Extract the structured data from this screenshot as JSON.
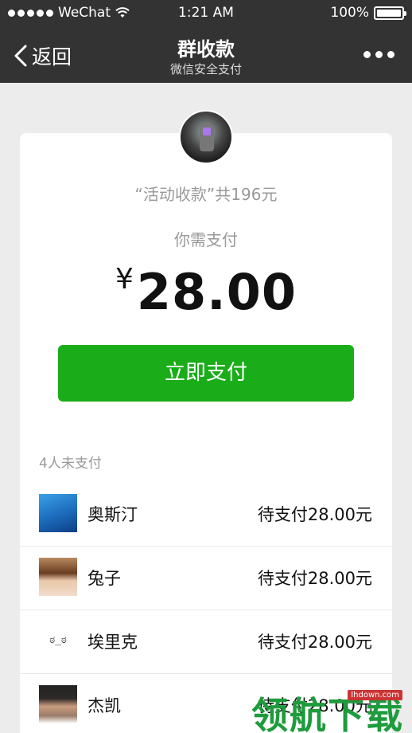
{
  "status_bar": {
    "carrier": "WeChat",
    "time": "1:21 AM",
    "battery": "100%",
    "signal_icon": "signal-dots-icon",
    "wifi_icon": "wifi-icon",
    "battery_icon": "battery-icon",
    "battery_level": 1.0
  },
  "nav": {
    "back_label": "返回",
    "title": "群收款",
    "subtitle": "微信安全支付",
    "back_icon": "chevron-left-icon",
    "more_icon": "more-dots-icon"
  },
  "payment": {
    "summary": "“活动收款”共196元",
    "need_pay_label": "你需支付",
    "currency": "¥",
    "amount": "28.00",
    "pay_button": "立即支付"
  },
  "unpaid": {
    "title": "4人未支付",
    "members": [
      {
        "name": "奥斯汀",
        "status": "待支付28.00元"
      },
      {
        "name": "兔子",
        "status": "待支付28.00元"
      },
      {
        "name": "埃里克",
        "status": "待支付28.00元",
        "avatar_text": "ಠ_ಠ"
      },
      {
        "name": "杰凯",
        "status": "待支付28.00元"
      }
    ]
  },
  "watermark": {
    "text": "领航下载",
    "url": "lhdown.com"
  },
  "colors": {
    "nav_bg": "#333333",
    "accent_green": "#1aad19",
    "page_bg": "#ececec"
  }
}
